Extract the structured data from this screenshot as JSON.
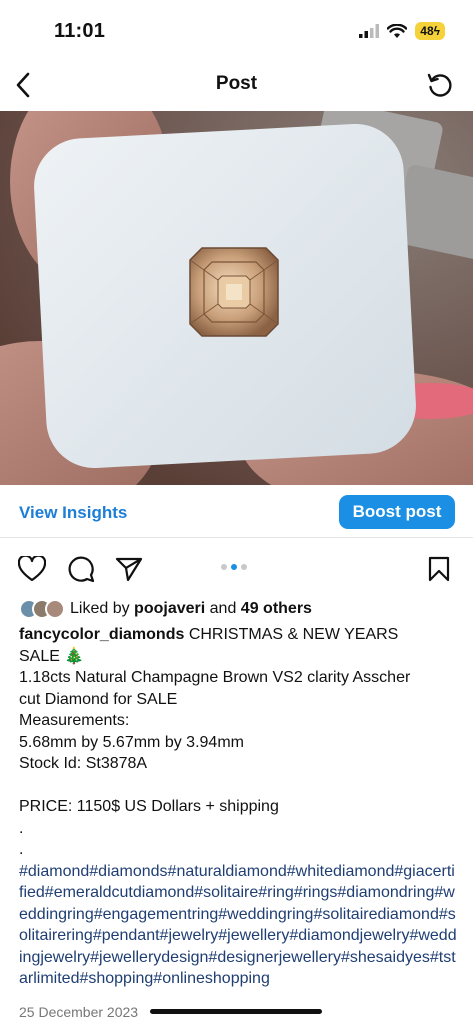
{
  "status_bar": {
    "time": "11:01",
    "battery": "48"
  },
  "header": {
    "title": "Post"
  },
  "insights": {
    "view_label": "View Insights",
    "boost_label": "Boost post"
  },
  "likes": {
    "prefix": "Liked by",
    "user": "poojaveri",
    "and": "and",
    "others": "49 others"
  },
  "caption": {
    "username": "fancycolor_diamonds",
    "line1_text": " CHRISTMAS & NEW YEARS",
    "line2": "SALE 🎄",
    "line3": "1.18cts Natural Champagne Brown VS2 clarity Asscher",
    "line4": "cut Diamond for SALE",
    "line5": "Measurements:",
    "line6": "5.68mm by 5.67mm by 3.94mm",
    "line7": "Stock Id: St3878A",
    "line8": "PRICE: 1150$ US Dollars + shipping",
    "dot1": ".",
    "dot2": ".",
    "hashtags": "#diamond#diamonds#naturaldiamond#whitediamond#giacertified#emeraldcutdiamond#solitaire#ring#rings#diamondring#weddingring#engagementring#weddingring#solitairediamond#solitairering#pendant#jewelry#jewellery#diamondjewelry#weddingjewelry#jewellerydesign#designerjewellery#shesaidyes#tstarlimited#shopping#onlineshopping"
  },
  "date": "25 December 2023",
  "colors": {
    "accent": "#1a8fe3",
    "link": "#1c7ed6",
    "hashtag": "#1f3e73",
    "battery": "#f5d13a"
  }
}
